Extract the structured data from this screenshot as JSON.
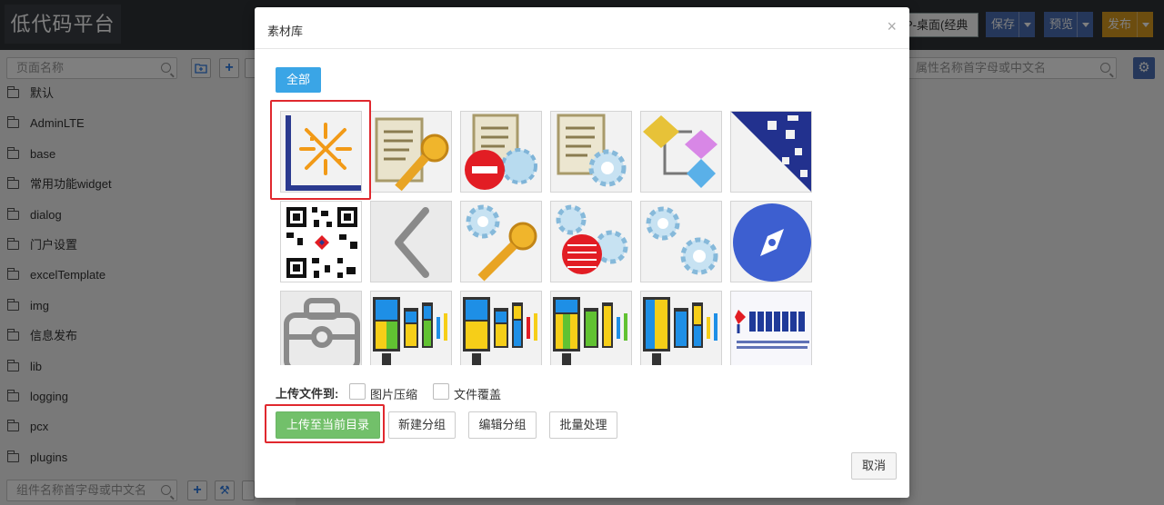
{
  "app": {
    "title": "低代码平台"
  },
  "toolbar": {
    "page_select_value": "P-桌面(经典",
    "save_label": "保存",
    "preview_label": "预览",
    "publish_label": "发布"
  },
  "sidebar": {
    "page_search_placeholder": "页面名称",
    "add_folder_label": "+",
    "items": [
      {
        "label": "默认"
      },
      {
        "label": "AdminLTE"
      },
      {
        "label": "base"
      },
      {
        "label": "常用功能widget"
      },
      {
        "label": "dialog"
      },
      {
        "label": "门户设置"
      },
      {
        "label": "excelTemplate"
      },
      {
        "label": "img"
      },
      {
        "label": "信息发布"
      },
      {
        "label": "lib"
      },
      {
        "label": "logging"
      },
      {
        "label": "pcx"
      },
      {
        "label": "plugins"
      }
    ],
    "component_search_placeholder": "组件名称首字母或中文名"
  },
  "right_panel": {
    "property_search_placeholder": "属性名称首字母或中文名"
  },
  "dialog": {
    "title": "素材库",
    "close_icon": "×",
    "category_all": "全部",
    "upload_to_label": "上传文件到:",
    "compress_label": "图片压缩",
    "overwrite_label": "文件覆盖",
    "upload_button": "上传至当前目录",
    "new_group_button": "新建分组",
    "edit_group_button": "编辑分组",
    "batch_button": "批量处理",
    "cancel_button": "取消",
    "assets": [
      {
        "icon": "chart-axis-icon"
      },
      {
        "icon": "document-key-icon"
      },
      {
        "icon": "document-stop-gear-icon"
      },
      {
        "icon": "document-gear-icon"
      },
      {
        "icon": "diagram-flow-icon"
      },
      {
        "icon": "qr-code-corner-icon"
      },
      {
        "icon": "qr-code-icon"
      },
      {
        "icon": "chevron-left-icon"
      },
      {
        "icon": "gear-key-icon"
      },
      {
        "icon": "gear-stop-icon"
      },
      {
        "icon": "gears-icon"
      },
      {
        "icon": "compass-icon"
      },
      {
        "icon": "toolbox-icon"
      },
      {
        "icon": "monitor-chart-icon"
      },
      {
        "icon": "monitor-chart-icon"
      },
      {
        "icon": "monitor-chart-icon"
      },
      {
        "icon": "monitor-chart-icon"
      },
      {
        "icon": "company-seal-icon"
      }
    ]
  }
}
